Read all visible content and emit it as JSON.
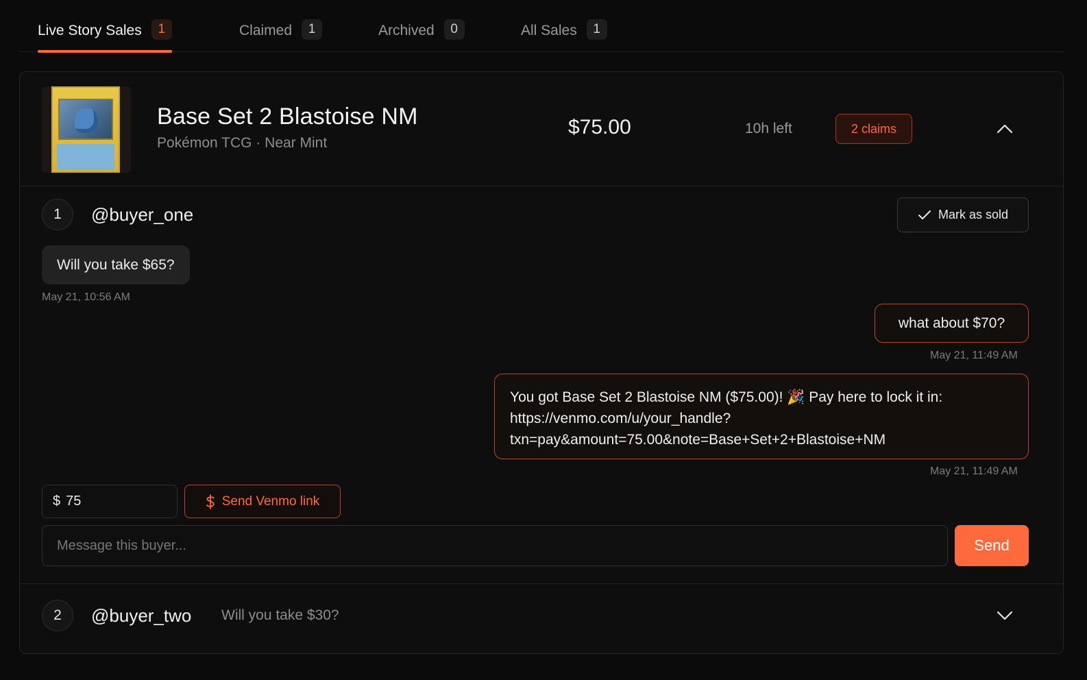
{
  "tabs": [
    {
      "label": "Live Story Sales",
      "count": "1",
      "active": true
    },
    {
      "label": "Claimed",
      "count": "1",
      "active": false
    },
    {
      "label": "Archived",
      "count": "0",
      "active": false
    },
    {
      "label": "All Sales",
      "count": "1",
      "active": false
    }
  ],
  "listing": {
    "title": "Base Set 2 Blastoise NM",
    "subtitle": "Pokémon TCG · Near Mint",
    "price": "$75.00",
    "time_left": "10h left",
    "claims": "2 claims"
  },
  "buyer1": {
    "number": "1",
    "handle": "@buyer_one",
    "mark_sold_label": "Mark as sold",
    "messages": [
      {
        "text": "Will you take $65?",
        "time": "May 21, 10:56 AM"
      },
      {
        "text": "what about $70?",
        "time": "May 21, 11:49 AM"
      },
      {
        "text_line1": "You got Base Set 2 Blastoise NM ($75.00)! 🎉 Pay here to lock it in:",
        "text_line2": "https://venmo.com/u/your_handle?",
        "text_line3": "txn=pay&amount=75.00&note=Base+Set+2+Blastoise+NM",
        "time": "May 21, 11:49 AM"
      }
    ],
    "currency_symbol": "$",
    "amount_value": "75",
    "venmo_label": "Send Venmo link",
    "message_placeholder": "Message this buyer...",
    "send_label": "Send"
  },
  "buyer2": {
    "number": "2",
    "handle": "@buyer_two",
    "preview": "Will you take $30?"
  },
  "colors": {
    "accent": "#ff6a3d",
    "background": "#0b0b0b"
  }
}
